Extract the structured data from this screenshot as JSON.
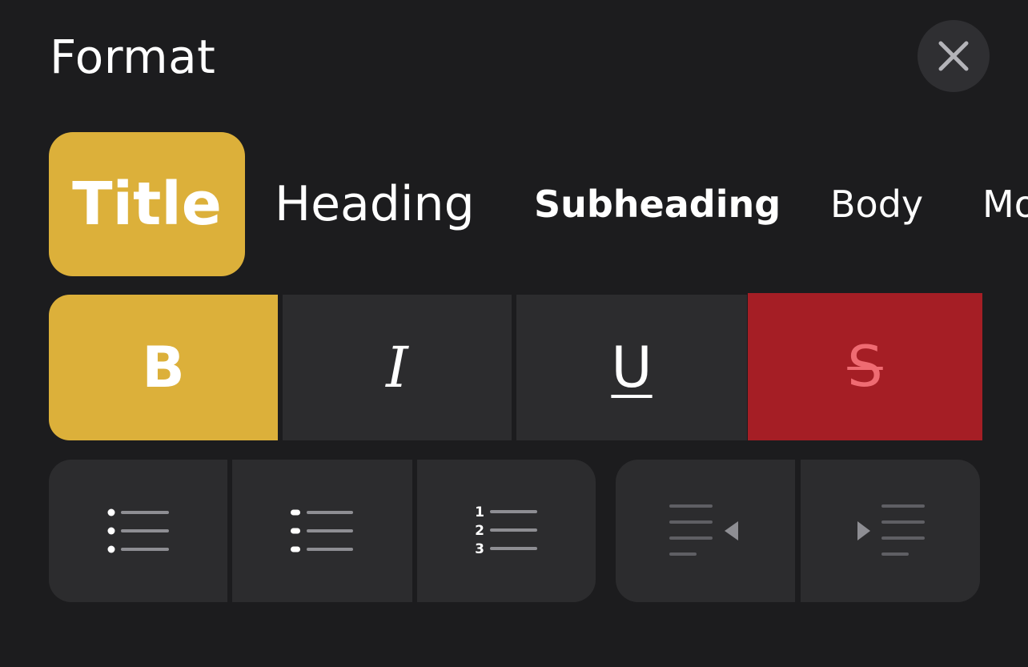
{
  "header": {
    "title": "Format"
  },
  "styles": {
    "items": [
      {
        "label": "Title",
        "selected": true
      },
      {
        "label": "Heading",
        "selected": false
      },
      {
        "label": "Subheading",
        "selected": false
      },
      {
        "label": "Body",
        "selected": false
      },
      {
        "label": "Mo",
        "selected": false
      }
    ]
  },
  "emphasis": {
    "bold": {
      "label": "B",
      "active": true
    },
    "italic": {
      "label": "I",
      "active": false
    },
    "underline": {
      "label": "U",
      "active": false
    },
    "strikethrough": {
      "label": "S",
      "active": true
    }
  },
  "lists": {
    "numbered_digits": [
      "1",
      "2",
      "3"
    ]
  },
  "colors": {
    "background": "#1c1c1e",
    "button": "#2c2c2e",
    "accent": "#dcb03a",
    "strike_active": "#a51e25",
    "strike_glyph": "#ef6b72",
    "icon_line": "#8e8e93"
  }
}
